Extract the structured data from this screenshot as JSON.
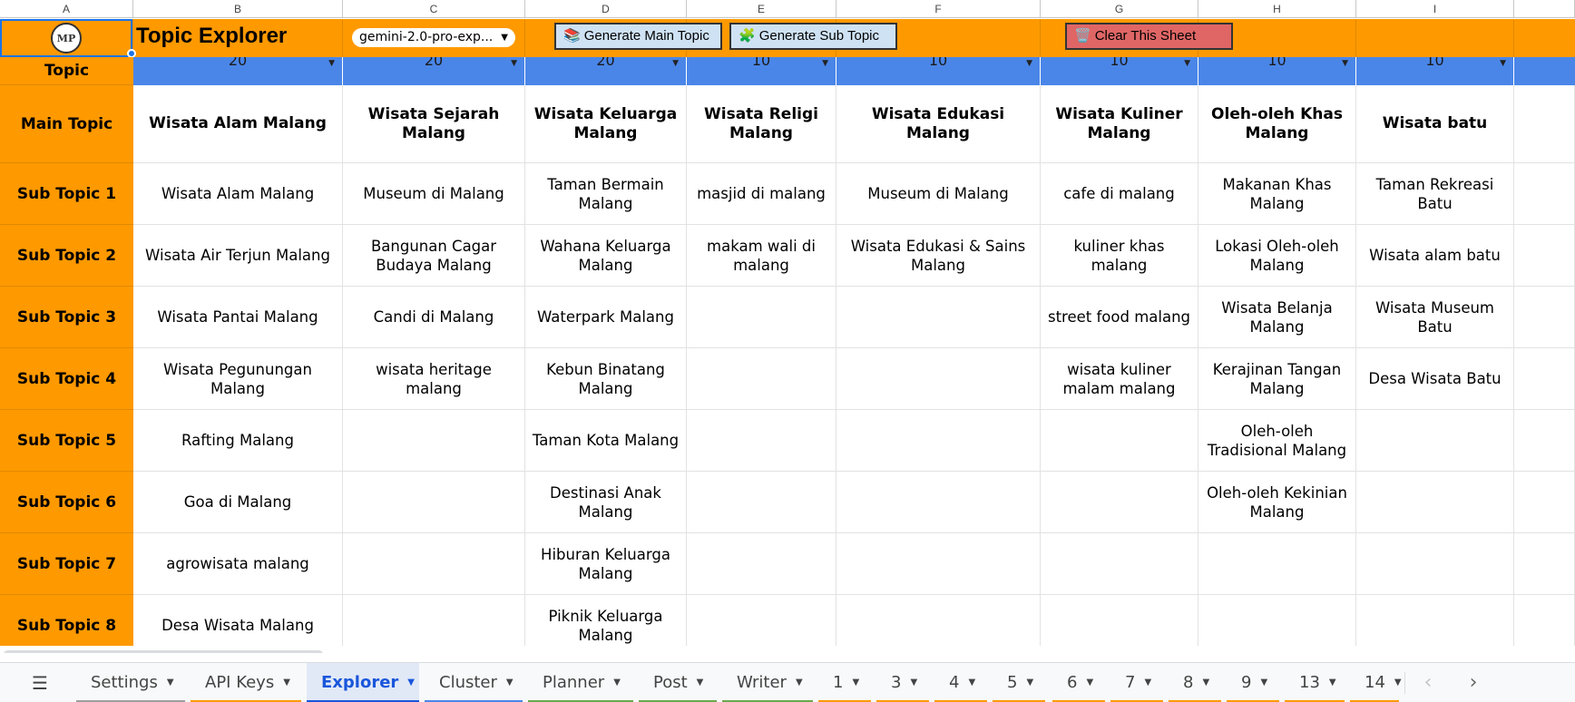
{
  "column_letters": [
    "A",
    "B",
    "C",
    "D",
    "E",
    "F",
    "G",
    "H",
    "I"
  ],
  "toolbar": {
    "logo_text": "MP",
    "title": "Topic Explorer",
    "model_select": "gemini-2.0-pro-exp...",
    "generate_main_label": "Generate Main Topic",
    "generate_sub_label": "Generate Sub Topic",
    "clear_label": "Clear This Sheet",
    "main_icon": "📚",
    "sub_icon": "🧩",
    "clear_icon": "🗑️"
  },
  "row_labels": {
    "topic": "Topic",
    "main_topic": "Main Topic",
    "sub_topics": [
      "Sub Topic 1",
      "Sub Topic 2",
      "Sub Topic 3",
      "Sub Topic 4",
      "Sub Topic 5",
      "Sub Topic 6",
      "Sub Topic 7",
      "Sub Topic 8"
    ]
  },
  "counts": [
    "20",
    "20",
    "20",
    "10",
    "10",
    "10",
    "10",
    "10"
  ],
  "main_topics": [
    "Wisata Alam Malang",
    "Wisata Sejarah Malang",
    "Wisata Keluarga Malang",
    "Wisata Religi Malang",
    "Wisata Edukasi Malang",
    "Wisata Kuliner Malang",
    "Oleh-oleh Khas Malang",
    "Wisata batu"
  ],
  "sub_topics": [
    [
      "Wisata Alam Malang",
      "Museum di Malang",
      "Taman Bermain Malang",
      "masjid di malang",
      "Museum di Malang",
      "cafe di malang",
      "Makanan Khas Malang",
      "Taman Rekreasi Batu"
    ],
    [
      "Wisata Air Terjun Malang",
      "Bangunan Cagar Budaya Malang",
      "Wahana Keluarga Malang",
      "makam wali di malang",
      "Wisata Edukasi & Sains Malang",
      "kuliner khas malang",
      "Lokasi Oleh-oleh Malang",
      "Wisata alam batu"
    ],
    [
      "Wisata Pantai Malang",
      "Candi di Malang",
      "Waterpark Malang",
      "",
      "",
      "street food malang",
      "Wisata Belanja Malang",
      "Wisata Museum Batu"
    ],
    [
      "Wisata Pegunungan Malang",
      "wisata heritage malang",
      "Kebun Binatang Malang",
      "",
      "",
      "wisata kuliner malam malang",
      "Kerajinan Tangan Malang",
      "Desa Wisata Batu"
    ],
    [
      "Rafting Malang",
      "",
      "Taman Kota Malang",
      "",
      "",
      "",
      "Oleh-oleh Tradisional Malang",
      ""
    ],
    [
      "Goa di Malang",
      "",
      "Destinasi Anak Malang",
      "",
      "",
      "",
      "Oleh-oleh Kekinian Malang",
      ""
    ],
    [
      "agrowisata malang",
      "",
      "Hiburan Keluarga Malang",
      "",
      "",
      "",
      "",
      ""
    ],
    [
      "Desa Wisata Malang",
      "",
      "Piknik Keluarga Malang",
      "",
      "",
      "",
      "",
      ""
    ]
  ],
  "sheet_tabs": [
    {
      "label": "Settings",
      "color": "#9e9e9e"
    },
    {
      "label": "API Keys",
      "color": "#ff9900"
    },
    {
      "label": "Explorer",
      "color": "#ff9900"
    },
    {
      "label": "Cluster",
      "color": "#4a86e8"
    },
    {
      "label": "Planner",
      "color": "#6aa84f"
    },
    {
      "label": "Post",
      "color": "#6aa84f"
    },
    {
      "label": "Writer",
      "color": "#6aa84f"
    },
    {
      "label": "1",
      "color": "#ff9900"
    },
    {
      "label": "3",
      "color": "#ff9900"
    },
    {
      "label": "4",
      "color": "#ff9900"
    },
    {
      "label": "5",
      "color": "#ff9900"
    },
    {
      "label": "6",
      "color": "#ff9900"
    },
    {
      "label": "7",
      "color": "#ff9900"
    },
    {
      "label": "8",
      "color": "#ff9900"
    },
    {
      "label": "9",
      "color": "#ff9900"
    },
    {
      "label": "13",
      "color": "#ff9900"
    },
    {
      "label": "14",
      "color": "#ff9900"
    }
  ],
  "active_tab": "Explorer",
  "colors": {
    "orange": "#ff9900",
    "blue_row": "#4a86e8",
    "button_blue": "#cfe2f3",
    "button_red": "#e06666",
    "active_tab": "#1a56db"
  }
}
